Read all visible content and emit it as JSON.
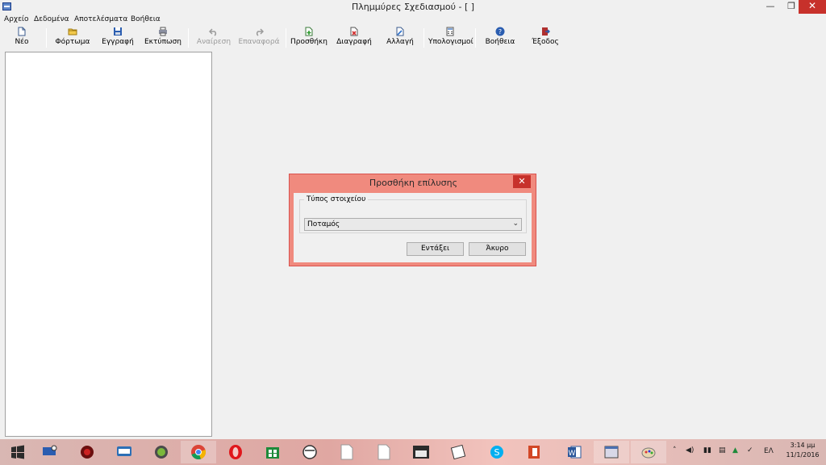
{
  "window": {
    "title": "Πλημμύρες Σχεδιασμού - [ ]",
    "minimize_glyph": "—",
    "restore_glyph": "❐",
    "close_glyph": "✕"
  },
  "menu": {
    "items": [
      "Αρχείο",
      "Δεδομένα",
      "Αποτελέσματα",
      "Βοήθεια"
    ]
  },
  "toolbar": {
    "buttons": [
      {
        "label": "Νέο",
        "icon": "new-file-icon",
        "enabled": true
      },
      {
        "label": "Φόρτωμα",
        "icon": "open-folder-icon",
        "enabled": true
      },
      {
        "label": "Εγγραφή",
        "icon": "save-disk-icon",
        "enabled": true
      },
      {
        "label": "Εκτύπωση",
        "icon": "printer-icon",
        "enabled": true
      },
      {
        "label": "Αναίρεση",
        "icon": "undo-icon",
        "enabled": false
      },
      {
        "label": "Επαναφορά",
        "icon": "redo-icon",
        "enabled": false
      },
      {
        "label": "Προσθήκη",
        "icon": "add-icon",
        "enabled": true
      },
      {
        "label": "Διαγραφή",
        "icon": "delete-icon",
        "enabled": true
      },
      {
        "label": "Αλλαγή",
        "icon": "edit-icon",
        "enabled": true
      },
      {
        "label": "Υπολογισμοί",
        "icon": "calculator-icon",
        "enabled": true
      },
      {
        "label": "Βοήθεια",
        "icon": "help-icon",
        "enabled": true
      },
      {
        "label": "Έξοδος",
        "icon": "exit-icon",
        "enabled": true
      }
    ]
  },
  "dialog": {
    "title": "Προσθήκη επίλυσης",
    "close_glyph": "✕",
    "group_label": "Τύπος στοιχείου",
    "select_value": "Ποταμός",
    "ok_label": "Εντάξει",
    "cancel_label": "Άκυρο"
  },
  "taskbar": {
    "apps": [
      "windows-start-icon",
      "remote-desktop-icon",
      "media-app-icon",
      "chat-app-icon",
      "evernote-icon",
      "chrome-icon",
      "opera-icon",
      "store-icon",
      "browser-app-icon",
      "document-icon",
      "document-icon",
      "video-player-icon",
      "notes-app-icon",
      "skype-icon",
      "office-app-icon",
      "word-icon",
      "app-window-icon",
      "paint-icon"
    ],
    "language": "ΕΛ",
    "time": "3:14 μμ",
    "date": "11/1/2016"
  },
  "colors": {
    "dialog_frame": "#f08a7e",
    "close_red": "#c7312b"
  }
}
